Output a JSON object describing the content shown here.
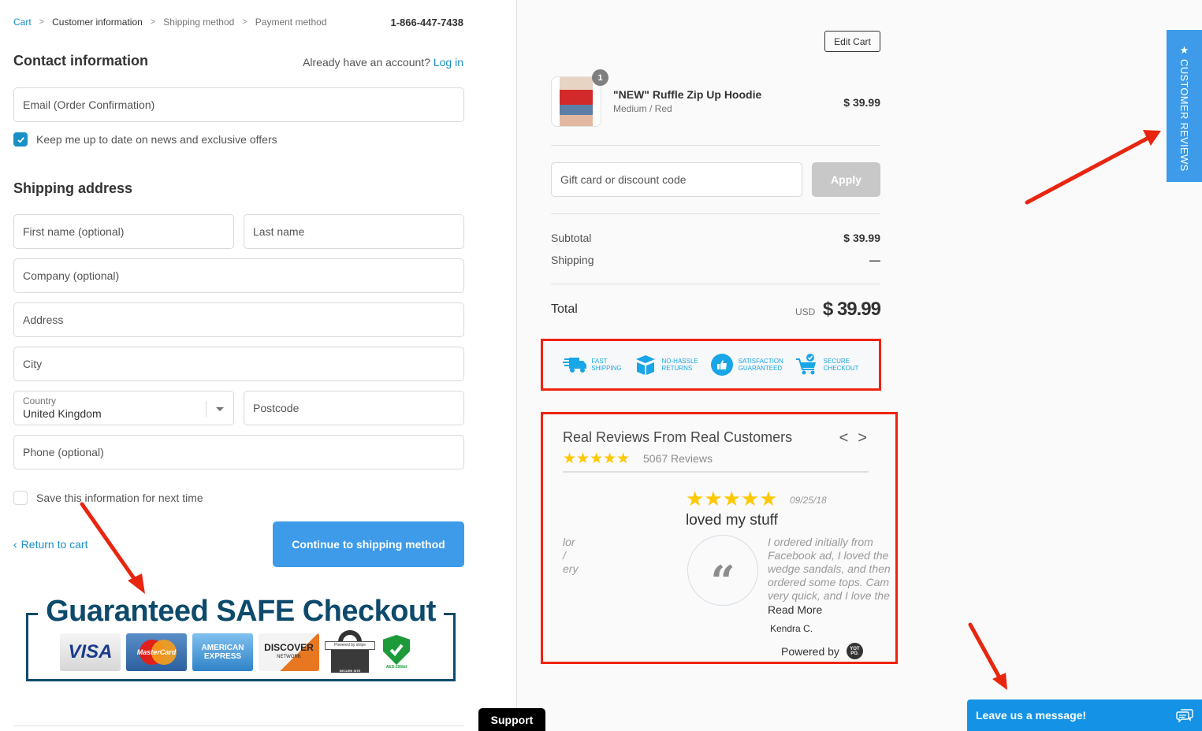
{
  "breadcrumb": [
    {
      "label": "Cart",
      "state": "link"
    },
    {
      "label": "Customer information",
      "state": "current"
    },
    {
      "label": "Shipping method",
      "state": "upcoming"
    },
    {
      "label": "Payment method",
      "state": "upcoming"
    }
  ],
  "header": {
    "phone": "1-866-447-7438"
  },
  "contact": {
    "title": "Contact information",
    "account_prompt": "Already have an account?",
    "login_label": "Log in",
    "email_placeholder": "Email (Order Confirmation)",
    "newsletter_label": "Keep me up to date on news and exclusive offers",
    "newsletter_checked": true
  },
  "shipping": {
    "title": "Shipping address",
    "first_name_placeholder": "First name (optional)",
    "last_name_placeholder": "Last name",
    "company_placeholder": "Company (optional)",
    "address_placeholder": "Address",
    "city_placeholder": "City",
    "country_label": "Country",
    "country_value": "United Kingdom",
    "postcode_placeholder": "Postcode",
    "phone_placeholder": "Phone (optional)",
    "save_info_label": "Save this information for next time",
    "save_info_checked": false
  },
  "actions": {
    "return_label": "Return to cart",
    "continue_label": "Continue to shipping method"
  },
  "safe_checkout": {
    "title": "Guaranteed SAFE Checkout",
    "badges": [
      "VISA",
      "MasterCard",
      "AMERICAN EXPRESS",
      "DISCOVER NETWORK",
      "Powered by stripe",
      "AES-256bit"
    ],
    "visa": "VISA",
    "mastercard": "MasterCard",
    "amex_1": "AMERICAN",
    "amex_2": "EXPRESS",
    "discover": "DISCOVER",
    "discover_sub": "NETWORK",
    "stripe": "Powered by stripe",
    "stripe_sub": "SECURE SITE",
    "aes": "AES-256bit"
  },
  "support": {
    "label": "Support"
  },
  "cart": {
    "edit_label": "Edit Cart",
    "item": {
      "name": "\"NEW\" Ruffle Zip Up Hoodie",
      "variant": "Medium / Red",
      "price": "$ 39.99",
      "quantity": "1"
    },
    "discount_placeholder": "Gift card or discount code",
    "apply_label": "Apply",
    "subtotal_label": "Subtotal",
    "subtotal_value": "$ 39.99",
    "shipping_label": "Shipping",
    "shipping_value": "—",
    "total_label": "Total",
    "total_currency": "USD",
    "total_value": "$ 39.99"
  },
  "trust": [
    {
      "icon": "truck-icon",
      "line1": "FAST",
      "line2": "SHIPPING"
    },
    {
      "icon": "box-icon",
      "line1": "NO-HASSLE",
      "line2": "RETURNS"
    },
    {
      "icon": "thumbs-up-icon",
      "line1": "SATISFACTION",
      "line2": "GUARANTEED"
    },
    {
      "icon": "cart-shield-icon",
      "line1": "SECURE",
      "line2": "CHECKOUT"
    }
  ],
  "reviews": {
    "title": "Real Reviews From Real Customers",
    "stars": "★★★★★",
    "rating": 5,
    "count_label": "5067 Reviews",
    "prev_fragment": [
      "lor",
      "/",
      "ery"
    ],
    "card": {
      "stars": "★★★★★",
      "rating": 5,
      "date": "09/25/18",
      "headline": "loved my stuff",
      "body_lines": [
        "I ordered initially from",
        "Facebook ad, I loved the",
        "wedge sandals, and then",
        "ordered some tops. Cam",
        "very quick, and I love the"
      ],
      "read_more": "Read More",
      "author": "Kendra C."
    },
    "powered_by": "Powered by",
    "yotpo_logo": "YOT PO."
  },
  "side_tab": {
    "label": "CUSTOMER REVIEWS",
    "icon": "★"
  },
  "chat": {
    "label": "Leave us a message!"
  },
  "colors": {
    "link": "#1990c6",
    "primary_button": "#3d9be9",
    "annotation_red": "#f0230f",
    "star": "#ffc800",
    "chat": "#1493e6"
  }
}
